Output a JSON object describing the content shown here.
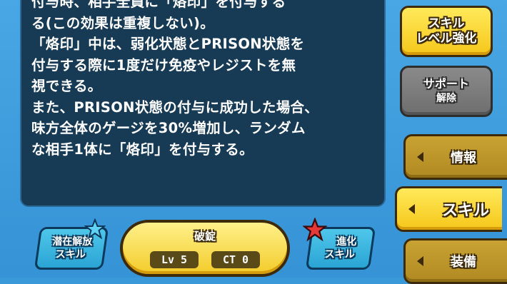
{
  "description": {
    "lines": [
      "付与時、相手全員に「烙印」を付与する",
      "る(この効果は重複しない)。",
      "「烙印」中は、弱化状態とPRISON状態を",
      "付与する際に1度だけ免疫やレジストを無",
      "視できる。",
      "また、PRISON状態の付与に成功した場合、",
      "味方全体のゲージを30%増加し、ランダム",
      "な相手1体に「烙印」を付与する。"
    ]
  },
  "buttons": {
    "skill_level_up": [
      "スキル",
      "レベル強化"
    ],
    "support_release": [
      "サポート",
      "解除"
    ]
  },
  "tabs": [
    {
      "label": "情報",
      "active": false
    },
    {
      "label": "スキル",
      "active": true
    },
    {
      "label": "装備",
      "active": false
    }
  ],
  "bottom": {
    "latent_release": [
      "潜在解放",
      "スキル"
    ],
    "evolution": [
      "進化",
      "スキル"
    ],
    "skill_name": "破錠",
    "level": "Lv 5",
    "ct": "CT 0"
  },
  "colors": {
    "panel": "#173a55",
    "yellow": "#f5c71a",
    "brown": "#b08a22",
    "background": "#3a9ad9"
  }
}
